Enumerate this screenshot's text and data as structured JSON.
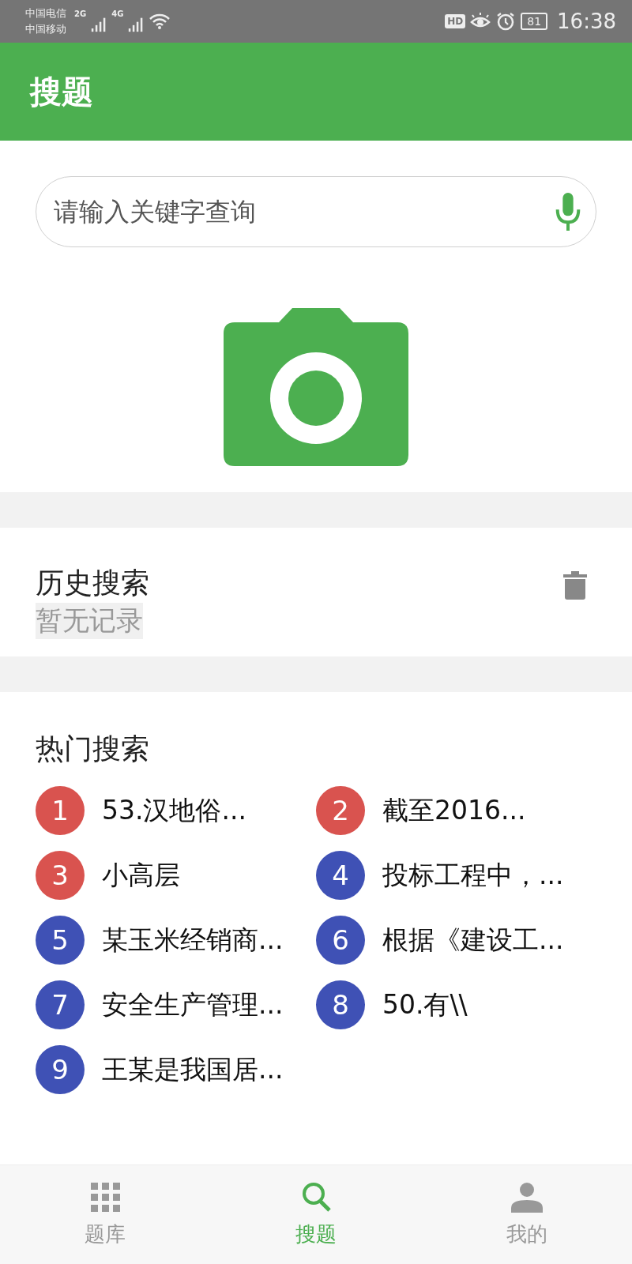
{
  "status_bar": {
    "carriers": [
      "中国电信",
      "中国移动"
    ],
    "networks": [
      "2G",
      "4G"
    ],
    "hd": "HD",
    "battery": "81",
    "time": "16:38"
  },
  "header": {
    "title": "搜题"
  },
  "search": {
    "placeholder": "请输入关键字查询"
  },
  "history": {
    "title": "历史搜索",
    "empty": "暂无记录"
  },
  "hot": {
    "title": "热门搜索",
    "items": [
      {
        "rank": "1",
        "text": "53.汉地俗...",
        "color": "#d9534f"
      },
      {
        "rank": "2",
        "text": "截至2016...",
        "color": "#d9534f"
      },
      {
        "rank": "3",
        "text": "小高层",
        "color": "#d9534f"
      },
      {
        "rank": "4",
        "text": "投标工程中，...",
        "color": "#3f51b5"
      },
      {
        "rank": "5",
        "text": "某玉米经销商...",
        "color": "#3f51b5"
      },
      {
        "rank": "6",
        "text": "根据《建设工...",
        "color": "#3f51b5"
      },
      {
        "rank": "7",
        "text": "安全生产管理...",
        "color": "#3f51b5"
      },
      {
        "rank": "8",
        "text": "50.有\\\\",
        "color": "#3f51b5"
      },
      {
        "rank": "9",
        "text": "王某是我国居...",
        "color": "#3f51b5"
      }
    ]
  },
  "nav": [
    {
      "label": "题库",
      "kind": "grid",
      "selected": false
    },
    {
      "label": "搜题",
      "kind": "search",
      "selected": true
    },
    {
      "label": "我的",
      "kind": "person",
      "selected": false
    }
  ]
}
